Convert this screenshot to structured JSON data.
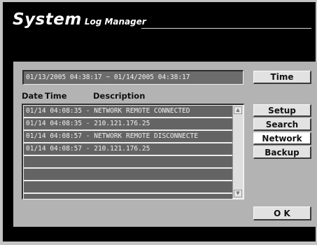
{
  "window": {
    "title_big": "System",
    "title_small": "Log Manager"
  },
  "date_range": "01/13/2005  04:38:17 ~ 01/14/2005  04:38:17",
  "buttons": {
    "time": "Time",
    "setup": "Setup",
    "search": "Search",
    "network": "Network",
    "backup": "Backup",
    "ok": "O K"
  },
  "columns": {
    "date": "Date",
    "time": "Time",
    "description": "Description"
  },
  "log_rows": [
    "01/14 04:08:35 - NETWORK REMOTE CONNECTED",
    "01/14 04:08:35 - 210.121.176.25",
    "01/14 04:08:57 - NETWORK REMOTE DISCONNECTE",
    "01/14 04:08:57 - 210.121.176.25",
    "",
    "",
    "",
    ""
  ],
  "selected_button": "network",
  "icons": {
    "scroll_up": "scroll-up-icon",
    "scroll_down": "scroll-down-icon"
  }
}
